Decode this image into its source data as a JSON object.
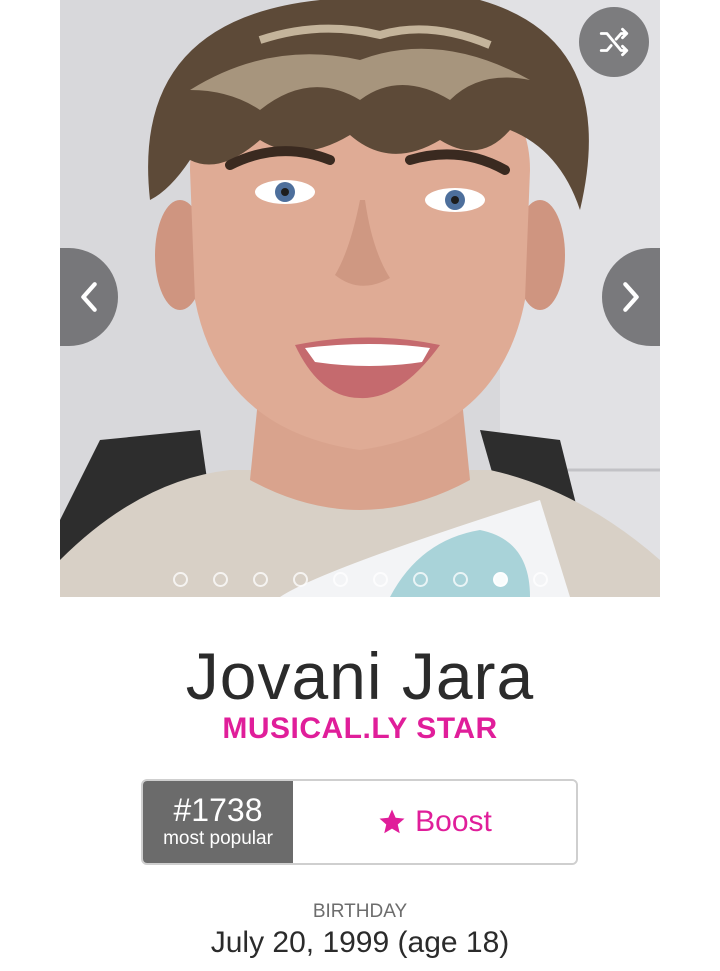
{
  "profile": {
    "name": "Jovani Jara",
    "occupation": "MUSICAL.LY STAR"
  },
  "carousel": {
    "photo_count": 10,
    "active_index": 8,
    "shuffle_icon": "shuffle-icon",
    "prev_icon": "chevron-left-icon",
    "next_icon": "chevron-right-icon"
  },
  "ranking": {
    "rank": "#1738",
    "label": "most popular"
  },
  "boost": {
    "label": "Boost",
    "icon": "star-icon"
  },
  "birthday": {
    "label": "BIRTHDAY",
    "value": "July 20, 1999 (age 18)"
  },
  "colors": {
    "accent": "#e01e9a",
    "rank_bg": "#6b6b6b",
    "overlay_button": "#5f5f62"
  }
}
